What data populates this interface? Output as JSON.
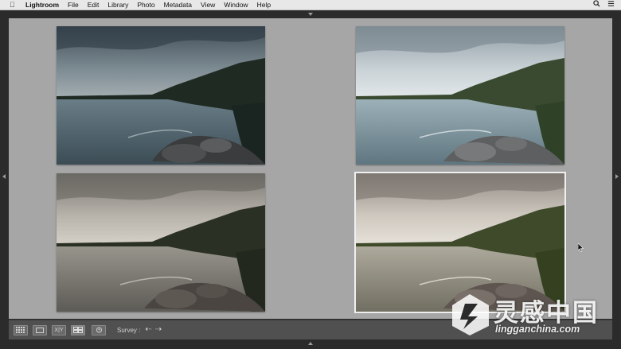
{
  "menubar": {
    "app": "Lightroom",
    "items": [
      "File",
      "Edit",
      "Library",
      "Photo",
      "Metadata",
      "View",
      "Window",
      "Help"
    ]
  },
  "photos": [
    {
      "id": "candidate-1",
      "tone": "cool-dark",
      "selected": false
    },
    {
      "id": "candidate-2",
      "tone": "cool-bright",
      "selected": false
    },
    {
      "id": "candidate-3",
      "tone": "warm-muted",
      "selected": false
    },
    {
      "id": "candidate-4",
      "tone": "warm-bright",
      "selected": true
    }
  ],
  "toolbar": {
    "compare_label": "X|Y",
    "survey_label": "Survey :"
  },
  "watermark": {
    "title": "灵感中国",
    "url": "lingganchina.com"
  },
  "colors": {
    "panel": "#a6a6a6",
    "background": "#2b2b2b",
    "toolbar": "#505050"
  }
}
